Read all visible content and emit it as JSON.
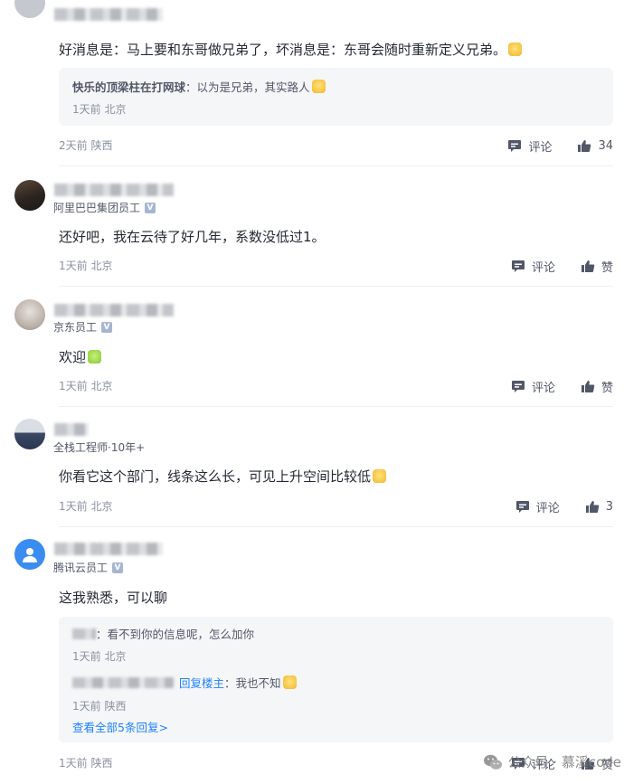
{
  "comments": [
    {
      "text": "好消息是：马上要和东哥做兄弟了，坏消息是：东哥会随时重新定义兄弟。",
      "reply": {
        "author": "快乐的顶梁柱在打网球",
        "sep": "：",
        "text": "以为是兄弟，其实路人",
        "meta": "1天前 北京"
      },
      "meta": "2天前 陕西",
      "comment_label": "评论",
      "like_label": "34"
    },
    {
      "subtitle": "阿里巴巴集团员工",
      "text": "还好吧，我在云待了好几年，系数没低过1。",
      "meta": "1天前 北京",
      "comment_label": "评论",
      "like_label": "赞"
    },
    {
      "subtitle": "京东员工",
      "text": "欢迎",
      "meta": "1天前 北京",
      "comment_label": "评论",
      "like_label": "赞"
    },
    {
      "subtitle": "全栈工程师·10年+",
      "text": "你看它这个部门，线条这么长，可见上升空间比较低",
      "meta": "1天前 北京",
      "comment_label": "评论",
      "like_label": "3"
    },
    {
      "subtitle": "腾讯云员工",
      "text": "这我熟悉，可以聊",
      "replies": [
        {
          "sep": "：",
          "text": "看不到你的信息呢，怎么加你",
          "meta": "1天前 北京"
        },
        {
          "reply_prefix": "回复楼主",
          "sep": "：",
          "text": "我也不知",
          "meta": "1天前 陕西"
        }
      ],
      "more_replies": "查看全部5条回复>",
      "meta": "1天前 陕西",
      "comment_label": "评论",
      "like_label": "赞"
    }
  ],
  "watermark": {
    "text": "公众号 · 慕溪code"
  },
  "colors": {
    "link": "#1e80ff",
    "meta": "#8a919f",
    "text": "#252933",
    "reply_bg": "#f5f6f8"
  }
}
